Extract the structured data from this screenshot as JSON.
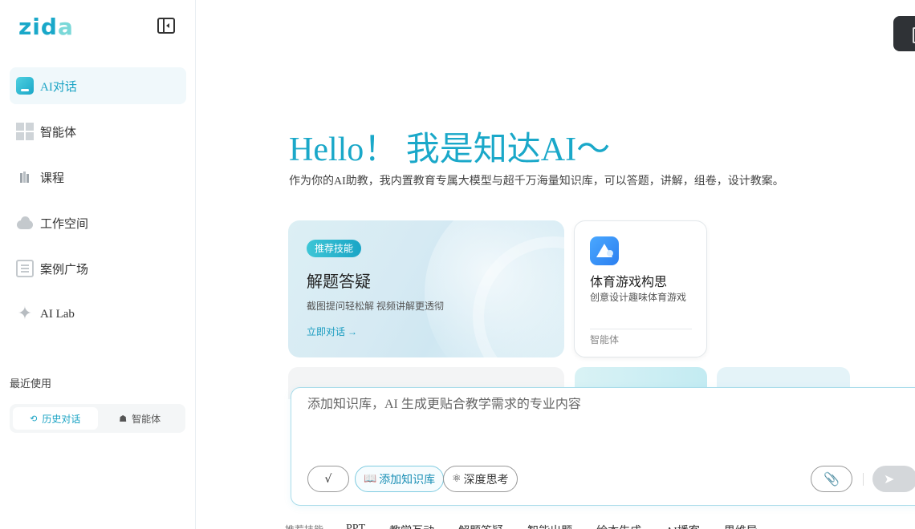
{
  "brand": {
    "logo_main": "zid",
    "logo_accent": "a"
  },
  "sidebar": {
    "items": [
      {
        "label": "AI对话",
        "icon": "chat-icon"
      },
      {
        "label": "智能体",
        "icon": "grid-icon"
      },
      {
        "label": "课程",
        "icon": "book-icon"
      },
      {
        "label": "工作空间",
        "icon": "cloud-icon"
      },
      {
        "label": "案例广场",
        "icon": "list-icon"
      },
      {
        "label": "AI Lab",
        "icon": "sparkle-icon"
      }
    ],
    "recent_title": "最近使用",
    "recent_tabs": [
      {
        "label": "历史对话",
        "icon": "history-icon"
      },
      {
        "label": "智能体",
        "icon": "robot-icon"
      }
    ]
  },
  "main": {
    "hello": "Hello！ 我是知达AI～",
    "subtitle": "作为你的AI助教，我内置教育专属大模型与超千万海量知识库，可以答题，讲解，组卷，设计教案。",
    "skill_card": {
      "badge": "推荐技能",
      "title": "解题答疑",
      "desc": "截图提问轻松解 视频讲解更透彻",
      "link": "立即对话 →"
    },
    "agent_card": {
      "title": "体育游戏构思",
      "desc": "创意设计趣味体育游戏",
      "tag": "智能体"
    },
    "input": {
      "placeholder": "添加知识库，AI 生成更贴合教学需求的专业内容",
      "check_label": "√",
      "kb_label": "添加知识库",
      "think_label": "深度思考"
    },
    "bottom": {
      "label": "推荐技能",
      "items": [
        "PPT",
        "教学互动",
        "解题答疑",
        "智能出题",
        "绘本生成",
        "AI播客",
        "思维导"
      ]
    }
  },
  "colors": {
    "accent": "#1aa8c9",
    "active_bg": "#f0f8fb"
  }
}
